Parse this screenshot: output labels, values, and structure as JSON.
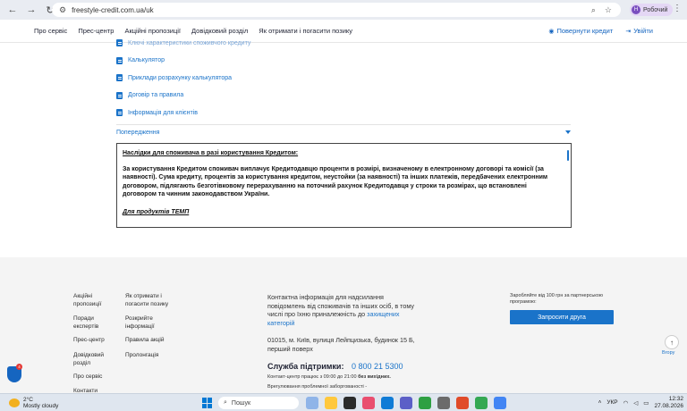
{
  "browser": {
    "url": "freestyle-credit.com.ua/uk",
    "profile_name": "Робочий",
    "profile_initial": "Н"
  },
  "header": {
    "nav": [
      "Про сервіс",
      "Прес-центр",
      "Акційні пропозиції",
      "Довідковий розділ",
      "Як отримати і погасити позику"
    ],
    "return_credit": "Повернути кредит",
    "login": "Увійти"
  },
  "documents": {
    "cut_item": "Ключі характеристики споживчого кредиту",
    "items": [
      "Калькулятор",
      "Приклади розрахунку калькулятора",
      "Договір та правила",
      "Інформація для клієнтів"
    ]
  },
  "warning": {
    "heading": "Попередження",
    "title": "Наслідки для споживача в разі користування Кредитом:",
    "body": "За користування Кредитом споживач виплачує Кредитодавцю проценти в розмірі, визначеному в електронному договорі та комісії (за наявності). Сума кредиту, процентів за користування кредитом, неустойки (за наявності) та інших платежів, передбачених електронним договором, підлягають безготівковому перерахуванню на поточний рахунок Кредитодавця у строки та розмірах, що встановлені договором та чинним законодавством України.",
    "link": "Для продуктів ТЕМП"
  },
  "footer": {
    "col1": [
      "Акційні пропозиції",
      "Поради експертів",
      "Прес-центр",
      "Довідковий розділ",
      "Про сервіс",
      "Контакти"
    ],
    "col2": [
      "Як отримати і погасити позику",
      "Розкрийте інформації",
      "Правила акцій",
      "Пролонгація"
    ],
    "contacts_text": "Контактна інформація для надсилання повідомлень від споживачів та інших осіб, в тому числі про їхню приналежність до",
    "contacts_link": "захищених категорій",
    "address": "01015, м. Київ, вулиця Лейпцизька, будинок 15 Б, перший поверх",
    "support_label": "Служба підтримки:",
    "support_phone": "0 800 21 5300",
    "hours_prefix": "Контакт-центр працює з 09:00 до 21:00",
    "hours_suffix": "без вихідних.",
    "reg": "Врегулювання проблемної заборгованості -",
    "referral_text": "Заробляйте від 100 грн за партнерською програмою:",
    "invite_button": "Запросити друга",
    "up_label": "Вгору",
    "badge_count": "4"
  },
  "taskbar": {
    "temperature": "2°C",
    "weather": "Mostly cloudy",
    "search": "Пошук",
    "lang": "УКР",
    "time": "12:32",
    "date": "27.08.2026"
  },
  "colors": {
    "accent": "#1a73c9",
    "footer_bg": "#f4f4f4"
  }
}
